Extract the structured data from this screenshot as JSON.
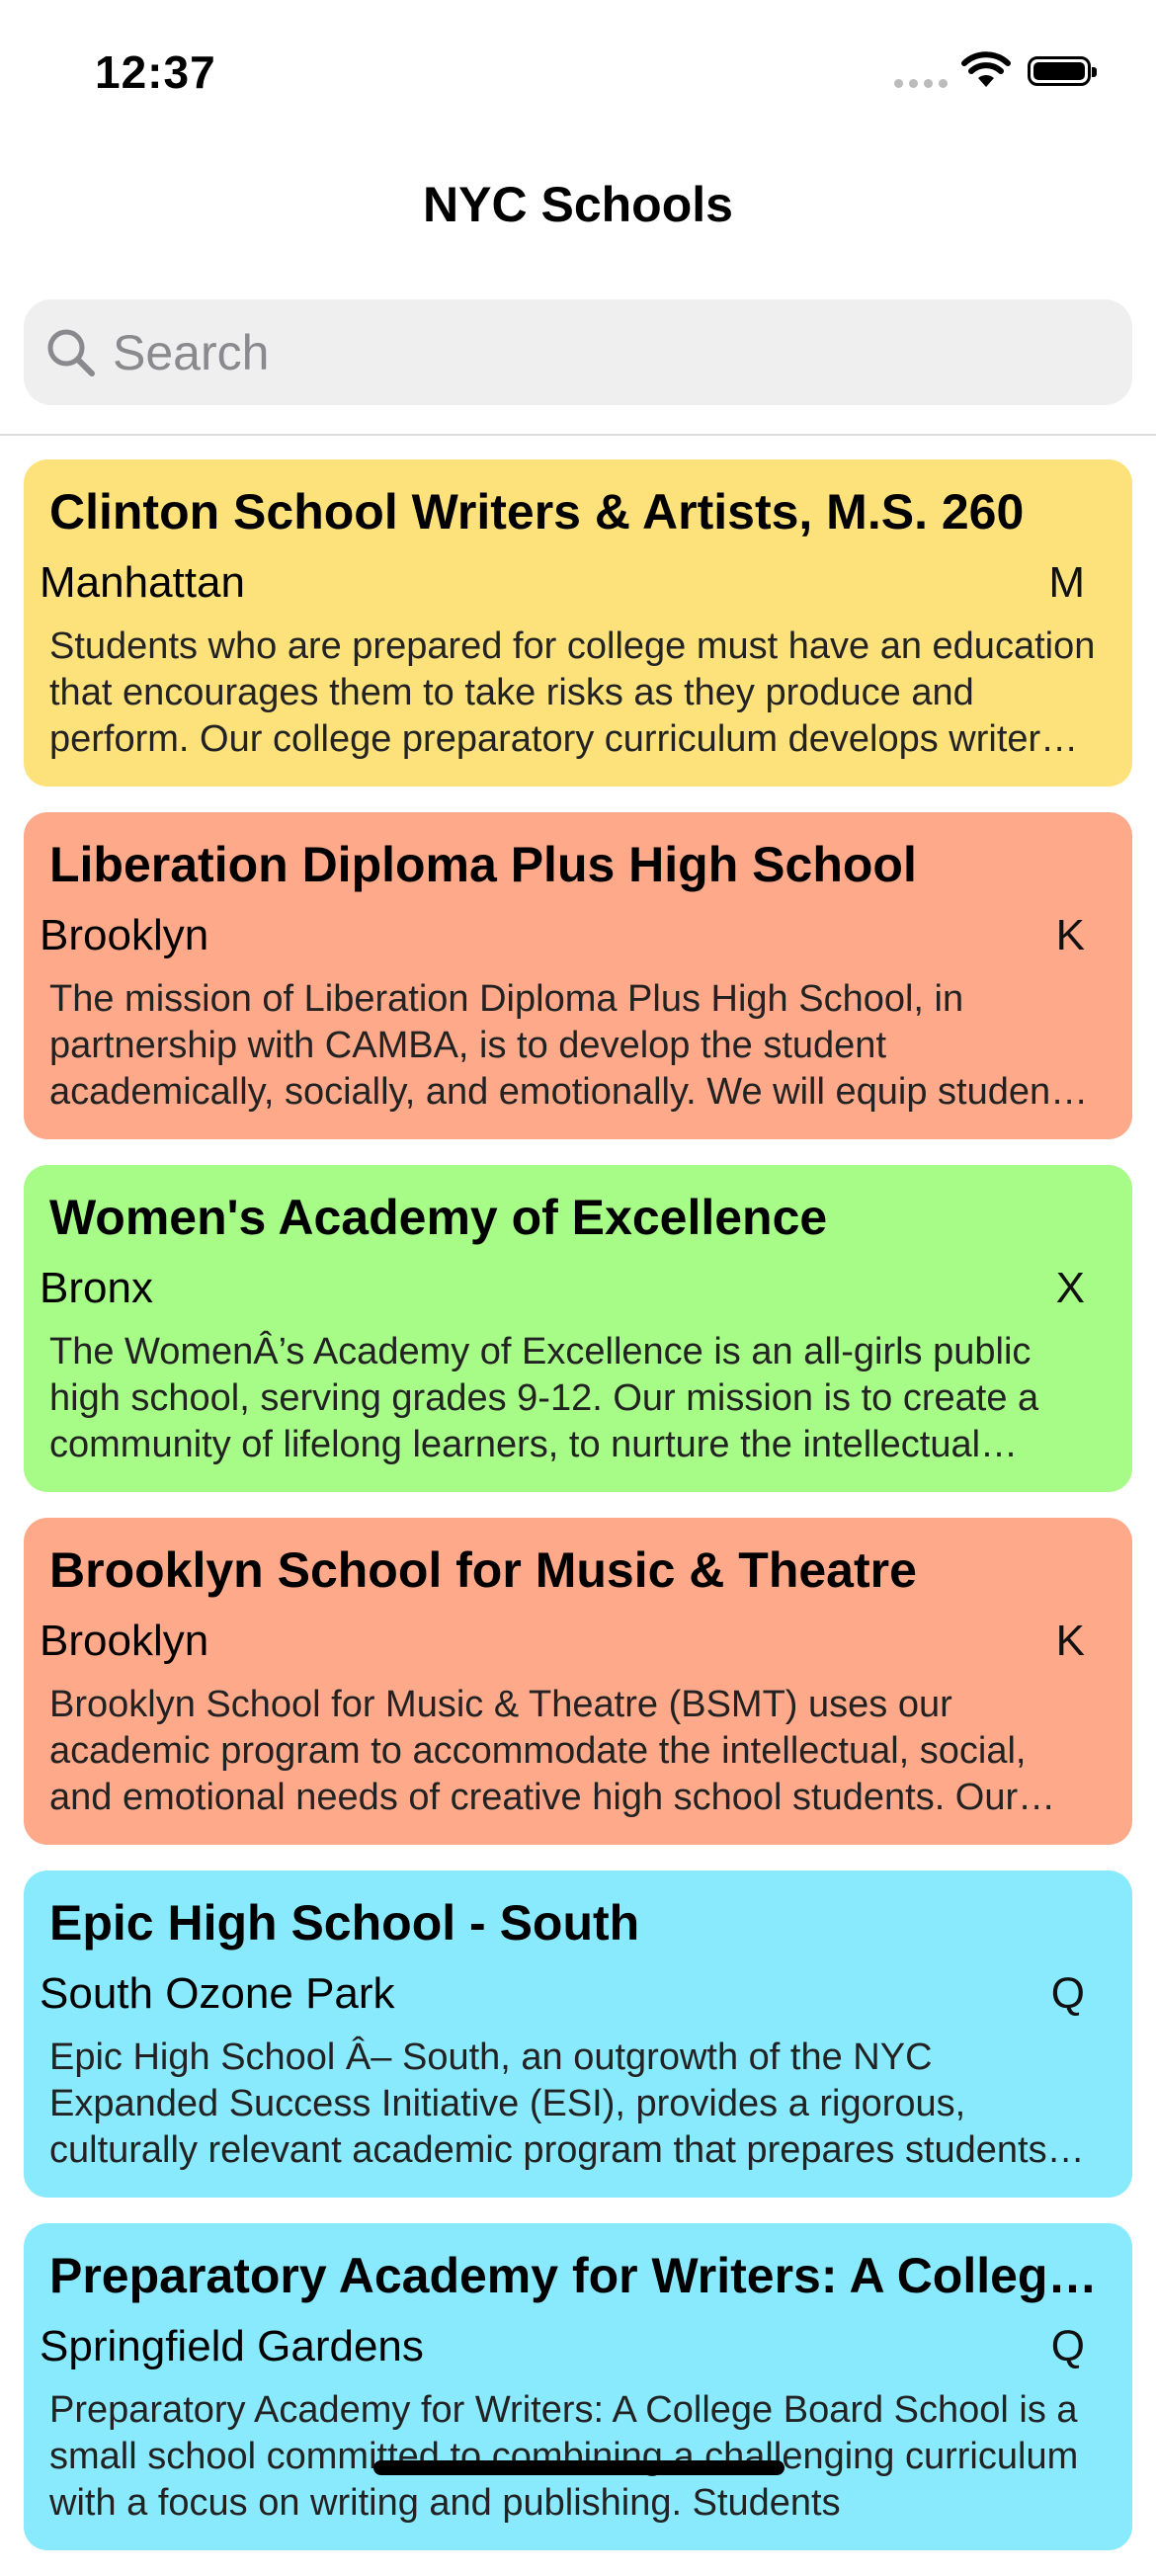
{
  "status_bar": {
    "time": "12:37"
  },
  "nav": {
    "title": "NYC Schools"
  },
  "search": {
    "placeholder": "Search",
    "value": ""
  },
  "schools": [
    {
      "name": "Clinton School Writers & Artists, M.S. 260",
      "borough": "Manhattan",
      "code": "M",
      "color": "#fde27c",
      "description": "Students who are prepared for college must have an education that encourages them to take risks as they produce and perform. Our college preparatory curriculum develops writers and artists."
    },
    {
      "name": "Liberation Diploma Plus High School",
      "borough": "Brooklyn",
      "code": "K",
      "color": "#fea98a",
      "description": "The mission of Liberation Diploma Plus High School, in partnership with CAMBA, is to develop the student academically, socially, and emotionally. We will equip students with the skills needed."
    },
    {
      "name": "Women's Academy of Excellence",
      "borough": "Bronx",
      "code": "X",
      "color": "#a6fc86",
      "description": "The WomenÂ’s Academy of Excellence is an all-girls public high school, serving grades 9-12. Our mission is to create a community of lifelong learners, to nurture the intellectual curiosity of students."
    },
    {
      "name": "Brooklyn School for Music & Theatre",
      "borough": "Brooklyn",
      "code": "K",
      "color": "#fea98a",
      "description": "Brooklyn School for Music & Theatre (BSMT) uses our academic program to accommodate the intellectual, social, and emotional needs of creative high school students. Our school community is dedicated."
    },
    {
      "name": "Epic High School - South",
      "borough": "South Ozone Park",
      "code": "Q",
      "color": "#89eafe",
      "description": "Epic High School Â– South, an outgrowth of the NYC Expanded Success Initiative (ESI), provides a rigorous, culturally relevant academic program that prepares students for college and careers."
    },
    {
      "name": "Preparatory Academy for Writers: A College Board School",
      "borough": "Springfield Gardens",
      "code": "Q",
      "color": "#89eafe",
      "description": "Preparatory Academy for Writers: A College Board School is a small school committed to combining a challenging curriculum with a focus on writing and publishing. Students"
    }
  ]
}
